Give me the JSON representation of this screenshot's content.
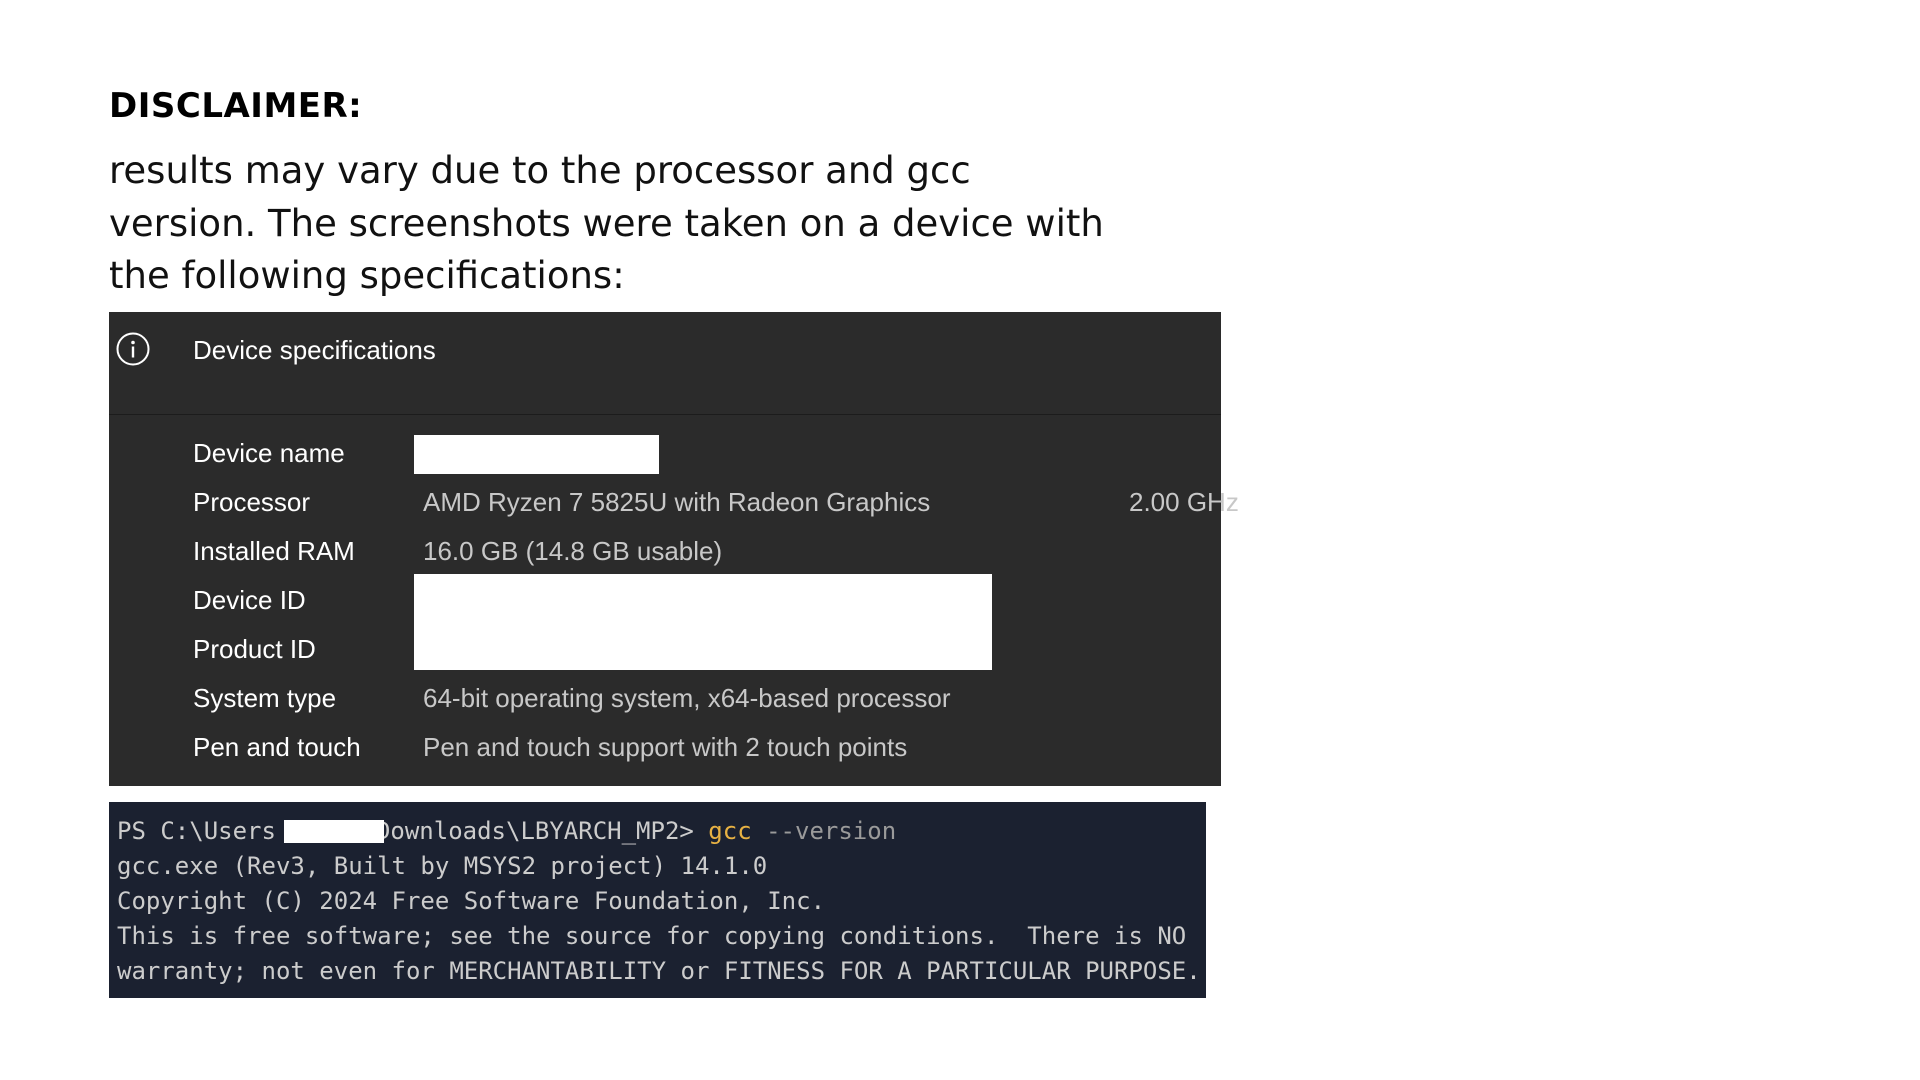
{
  "disclaimer": {
    "heading": "DISCLAIMER:",
    "lines": [
      "results may vary due to the processor and gcc",
      "version. The screenshots were taken on a device with",
      "the following specifications:"
    ]
  },
  "specs": {
    "title": "Device specifications",
    "icon": "info-icon",
    "rows": [
      {
        "label": "Device name",
        "value": ""
      },
      {
        "label": "Processor",
        "value": "AMD Ryzen 7 5825U with Radeon Graphics",
        "extra": "2.00 GHz"
      },
      {
        "label": "Installed RAM",
        "value": "16.0 GB (14.8 GB usable)"
      },
      {
        "label": "Device ID",
        "value": ""
      },
      {
        "label": "Product ID",
        "value": ""
      },
      {
        "label": "System type",
        "value": "64-bit operating system, x64-based processor"
      },
      {
        "label": "Pen and touch",
        "value": "Pen and touch support with 2 touch points"
      }
    ]
  },
  "terminal": {
    "prompt_start": "PS C:\\Users",
    "prompt_end": "Downloads\\LBYARCH_MP2> ",
    "command": "gcc",
    "argument": " --version",
    "output": [
      "gcc.exe (Rev3, Built by MSYS2 project) 14.1.0",
      "Copyright (C) 2024 Free Software Foundation, Inc.",
      "This is free software; see the source for copying conditions.  There is NO",
      "warranty; not even for MERCHANTABILITY or FITNESS FOR A PARTICULAR PURPOSE."
    ]
  },
  "colors": {
    "panel_bg": "#2b2b2b",
    "terminal_bg": "#1b2130",
    "command_color": "#e8b243"
  }
}
